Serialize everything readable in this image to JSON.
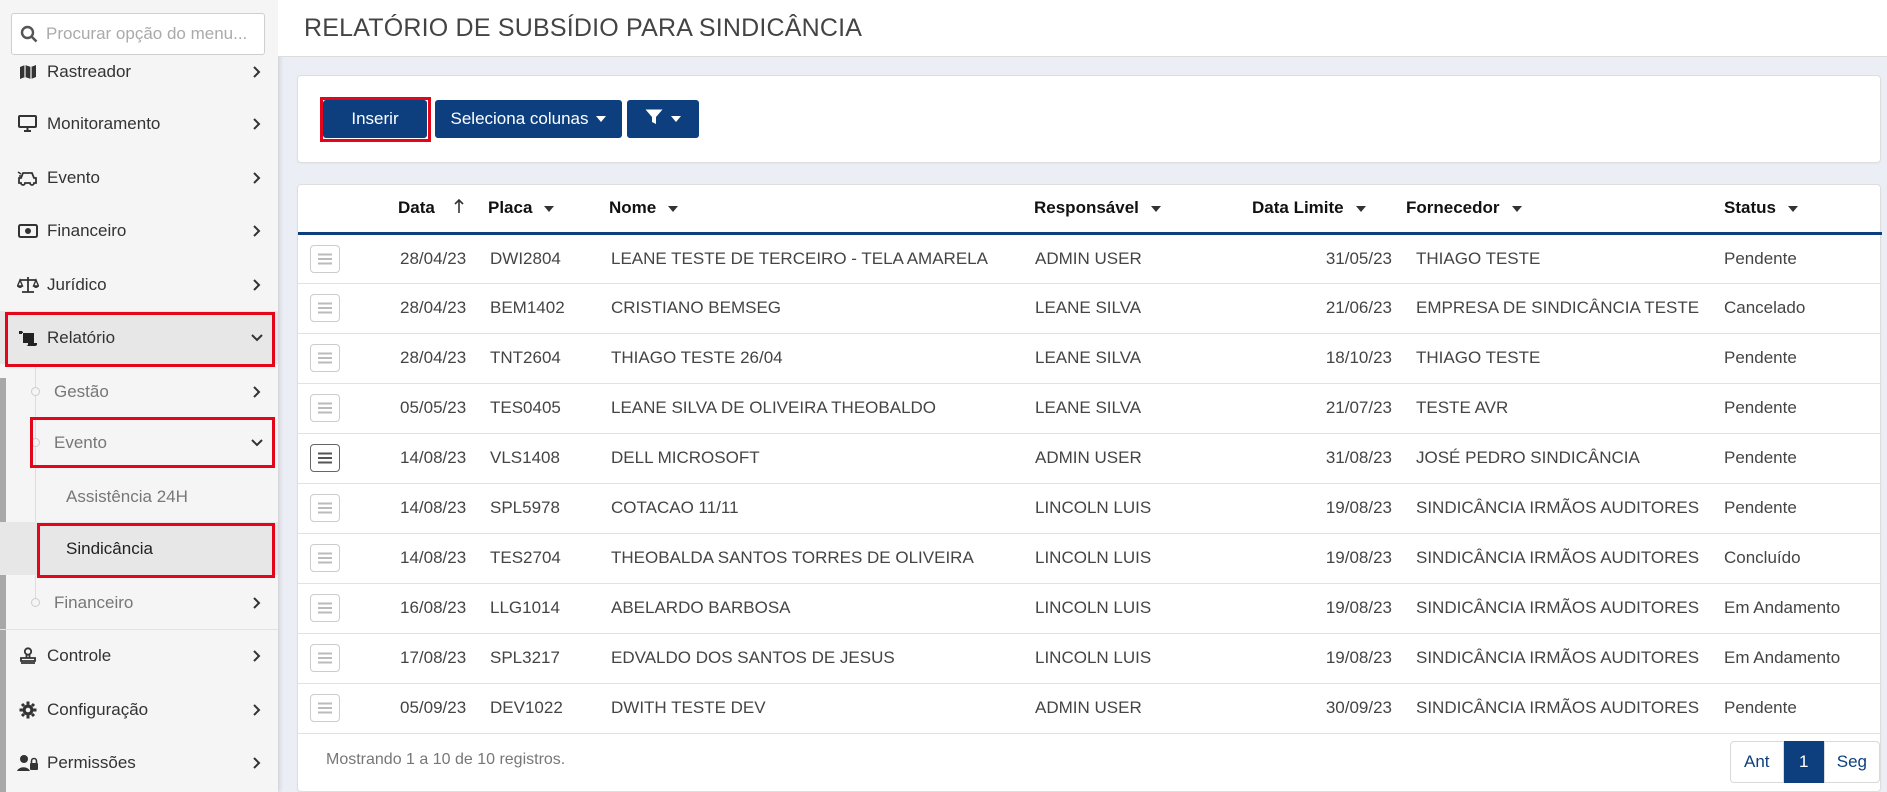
{
  "sidebar": {
    "search_placeholder": "Procurar opção do menu...",
    "items": [
      {
        "label": "Rastreador",
        "icon": "map-icon"
      },
      {
        "label": "Monitoramento",
        "icon": "monitor-icon"
      },
      {
        "label": "Evento",
        "icon": "car-crash-icon"
      },
      {
        "label": "Financeiro",
        "icon": "money-bill-icon"
      },
      {
        "label": "Jurídico",
        "icon": "scale-icon"
      },
      {
        "label": "Relatório",
        "icon": "scroll-icon"
      },
      {
        "label": "Gestão"
      },
      {
        "label": "Evento"
      },
      {
        "label": "Assistência 24H"
      },
      {
        "label": "Sindicância"
      },
      {
        "label": "Financeiro"
      },
      {
        "label": "Controle",
        "icon": "stamp-icon"
      },
      {
        "label": "Configuração",
        "icon": "gear-icon"
      },
      {
        "label": "Permissões",
        "icon": "user-lock-icon"
      }
    ]
  },
  "header": {
    "title": "RELATÓRIO DE SUBSÍDIO PARA SINDICÂNCIA"
  },
  "toolbar": {
    "insert_label": "Inserir",
    "columns_label": "Seleciona colunas"
  },
  "table": {
    "columns": [
      "Data",
      "Placa",
      "Nome",
      "Responsável",
      "Data Limite",
      "Fornecedor",
      "Status"
    ],
    "rows": [
      [
        "28/04/23",
        "DWI2804",
        "LEANE TESTE DE TERCEIRO - TELA AMARELA",
        "ADMIN USER",
        "31/05/23",
        "THIAGO TESTE",
        "Pendente"
      ],
      [
        "28/04/23",
        "BEM1402",
        "CRISTIANO BEMSEG",
        "LEANE SILVA",
        "21/06/23",
        "EMPRESA DE SINDICÂNCIA TESTE",
        "Cancelado"
      ],
      [
        "28/04/23",
        "TNT2604",
        "THIAGO TESTE 26/04",
        "LEANE SILVA",
        "18/10/23",
        "THIAGO TESTE",
        "Pendente"
      ],
      [
        "05/05/23",
        "TES0405",
        "LEANE SILVA DE OLIVEIRA THEOBALDO",
        "LEANE SILVA",
        "21/07/23",
        "TESTE AVR",
        "Pendente"
      ],
      [
        "14/08/23",
        "VLS1408",
        "DELL MICROSOFT",
        "ADMIN USER",
        "31/08/23",
        "JOSÉ PEDRO SINDICÂNCIA",
        "Pendente"
      ],
      [
        "14/08/23",
        "SPL5978",
        "COTACAO 11/11",
        "LINCOLN LUIS",
        "19/08/23",
        "SINDICÂNCIA IRMÃOS AUDITORES",
        "Pendente"
      ],
      [
        "14/08/23",
        "TES2704",
        "THEOBALDA SANTOS TORRES DE OLIVEIRA",
        "LINCOLN LUIS",
        "19/08/23",
        "SINDICÂNCIA IRMÃOS AUDITORES",
        "Concluído"
      ],
      [
        "16/08/23",
        "LLG1014",
        "ABELARDO BARBOSA",
        "LINCOLN LUIS",
        "19/08/23",
        "SINDICÂNCIA IRMÃOS AUDITORES",
        "Em Andamento"
      ],
      [
        "17/08/23",
        "SPL3217",
        "EDVALDO DOS SANTOS DE JESUS",
        "LINCOLN LUIS",
        "19/08/23",
        "SINDICÂNCIA IRMÃOS AUDITORES",
        "Em Andamento"
      ],
      [
        "05/09/23",
        "DEV1022",
        "DWITH TESTE DEV",
        "ADMIN USER",
        "30/09/23",
        "SINDICÂNCIA IRMÃOS AUDITORES",
        "Pendente"
      ]
    ],
    "footer": "Mostrando 1 a 10 de 10 registros."
  },
  "pagination": {
    "prev": "Ant",
    "current": "1",
    "next": "Seg"
  },
  "colors": {
    "primary": "#0d3f7f",
    "highlight": "#e3061b"
  }
}
